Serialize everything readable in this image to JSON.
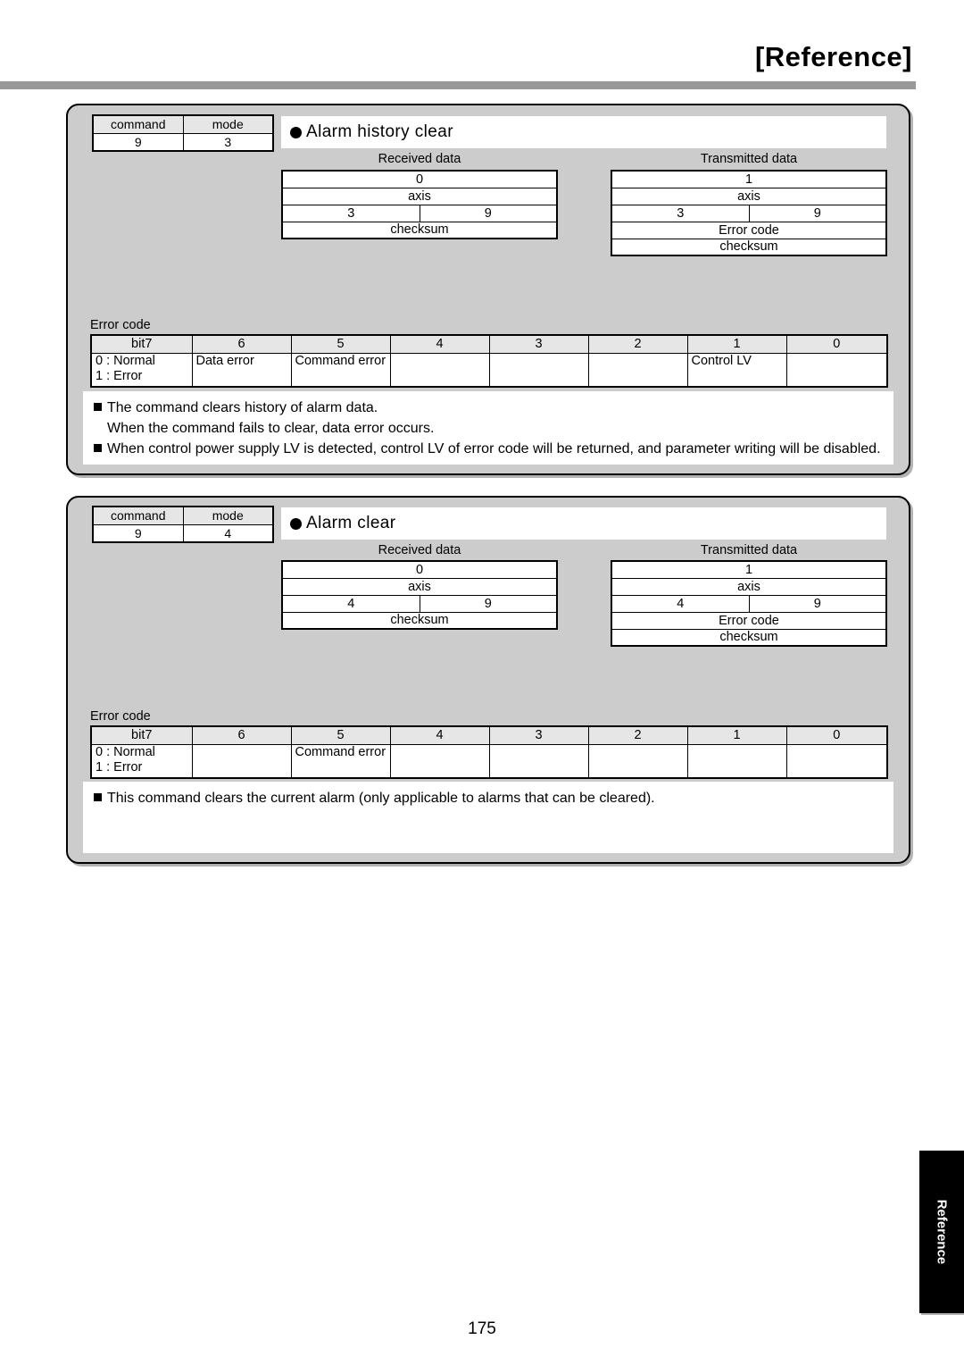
{
  "header": {
    "title": "[Reference]"
  },
  "page_number": "175",
  "side_tab": {
    "label": "Reference"
  },
  "common": {
    "cmd_header": [
      "command",
      "mode"
    ],
    "received_caption": "Received data",
    "transmitted_caption": "Transmitted data",
    "error_code_caption": "Error code",
    "bit_headers": [
      "bit7",
      "6",
      "5",
      "4",
      "3",
      "2",
      "1",
      "0"
    ],
    "normal_label": "0 : Normal",
    "error_label": "1 : Error",
    "axis_label": "axis",
    "checksum_label": "checksum",
    "error_code_label": "Error code"
  },
  "blocks": [
    {
      "command": "9",
      "mode": "3",
      "title": "Alarm history clear",
      "received": {
        "caption": "Received data",
        "rows": [
          "0",
          "axis"
        ],
        "pair": [
          "3",
          "9"
        ],
        "tail": [
          "checksum"
        ]
      },
      "transmitted": {
        "caption": "Transmitted data",
        "rows": [
          "1",
          "axis"
        ],
        "pair": [
          "3",
          "9"
        ],
        "tail": [
          "Error code",
          "checksum"
        ]
      },
      "error_code": {
        "caption": "Error code",
        "headers": [
          "bit7",
          "6",
          "5",
          "4",
          "3",
          "2",
          "1",
          "0"
        ],
        "values": [
          "",
          "Data error",
          "Command error",
          "",
          "",
          "",
          "Control LV",
          ""
        ],
        "first_cell_line1": "0 : Normal",
        "first_cell_line2": "1 : Error"
      },
      "notes": [
        {
          "bullet": true,
          "text": "The command clears history of alarm data."
        },
        {
          "bullet": false,
          "text": "When the command fails to clear, data error occurs."
        },
        {
          "bullet": true,
          "text": "When control power supply LV is detected, control LV of error code will be returned, and parameter writing will be disabled."
        }
      ]
    },
    {
      "command": "9",
      "mode": "4",
      "title": "Alarm clear",
      "received": {
        "caption": "Received data",
        "rows": [
          "0",
          "axis"
        ],
        "pair": [
          "4",
          "9"
        ],
        "tail": [
          "checksum"
        ]
      },
      "transmitted": {
        "caption": "Transmitted data",
        "rows": [
          "1",
          "axis"
        ],
        "pair": [
          "4",
          "9"
        ],
        "tail": [
          "Error code",
          "checksum"
        ]
      },
      "error_code": {
        "caption": "Error code",
        "headers": [
          "bit7",
          "6",
          "5",
          "4",
          "3",
          "2",
          "1",
          "0"
        ],
        "values": [
          "",
          "",
          "Command error",
          "",
          "",
          "",
          "",
          ""
        ],
        "first_cell_line1": "0 : Normal",
        "first_cell_line2": "1 : Error"
      },
      "notes": [
        {
          "bullet": true,
          "text": "This command clears the current alarm (only applicable to alarms that can be cleared)."
        }
      ]
    }
  ]
}
